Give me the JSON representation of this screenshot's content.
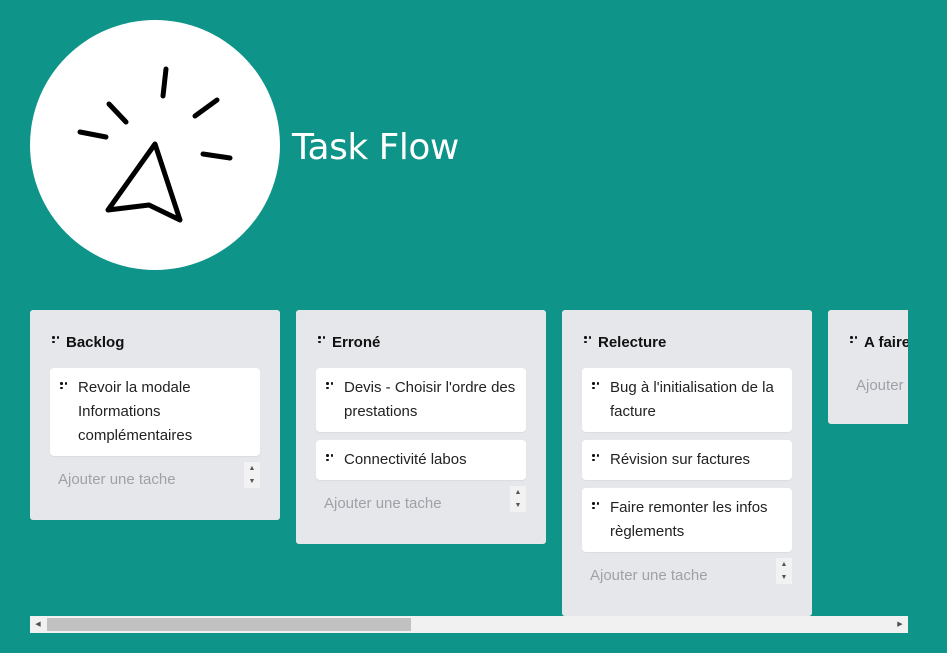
{
  "app": {
    "title": "Task Flow"
  },
  "columns": [
    {
      "title": "Backlog",
      "cards": [
        {
          "text": "Revoir la modale Informations complémentaires"
        }
      ],
      "add_placeholder": "Ajouter une tache"
    },
    {
      "title": "Erroné",
      "cards": [
        {
          "text": "Devis - Choisir l'ordre des prestations"
        },
        {
          "text": "Connectivité labos"
        }
      ],
      "add_placeholder": "Ajouter une tache"
    },
    {
      "title": "Relecture",
      "cards": [
        {
          "text": "Bug à l'initialisation de la facture"
        },
        {
          "text": "Révision sur factures"
        },
        {
          "text": "Faire remonter les infos règlements"
        }
      ],
      "add_placeholder": "Ajouter une tache"
    },
    {
      "title": "A faire",
      "cards": [],
      "add_placeholder": "Ajouter une tache"
    }
  ],
  "icons": {
    "logo": "cursor-click-icon",
    "drag": "drag-handle-icon",
    "spinner_up": "chevron-up-icon",
    "spinner_down": "chevron-down-icon",
    "scroll_left": "scroll-left-arrow-icon",
    "scroll_right": "scroll-right-arrow-icon"
  },
  "colors": {
    "background": "#0e9488",
    "column": "#e6e7eb",
    "card": "#ffffff",
    "placeholder": "#9ea1a8"
  }
}
